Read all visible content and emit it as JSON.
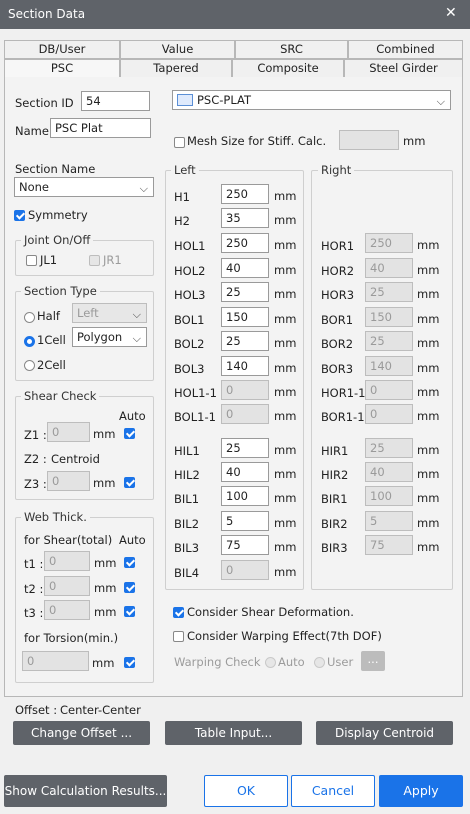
{
  "window": {
    "title": "Section Data",
    "close": "✕"
  },
  "tabs_row1": [
    "DB/User",
    "Value",
    "SRC",
    "Combined"
  ],
  "tabs_row2": [
    "PSC",
    "Tapered",
    "Composite",
    "Steel Girder"
  ],
  "section_id": {
    "label": "Section ID",
    "value": "54"
  },
  "name": {
    "label": "Name",
    "value": "PSC Plat"
  },
  "section_type_select": {
    "value": "PSC-PLAT"
  },
  "mesh": {
    "label": "Mesh Size for Stiff. Calc.",
    "unit": "mm",
    "value": ""
  },
  "section_name": {
    "label": "Section Name",
    "value": "None"
  },
  "symmetry": {
    "label": "Symmetry"
  },
  "joint": {
    "title": "Joint On/Off",
    "jl1": "JL1",
    "jr1": "JR1"
  },
  "stype": {
    "title": "Section Type",
    "half": "Half",
    "half_select": "Left",
    "cell1": "1Cell",
    "cell1_select": "Polygon",
    "cell2": "2Cell"
  },
  "shear": {
    "title": "Shear Check",
    "auto": "Auto",
    "z1": "Z1 :",
    "z1_val": "0",
    "z1_unit": "mm",
    "z2": "Z2 :",
    "z2_val": "Centroid",
    "z3": "Z3 :",
    "z3_val": "0",
    "z3_unit": "mm"
  },
  "web": {
    "title": "Web Thick.",
    "for_shear": "for Shear(total)",
    "auto": "Auto",
    "t1": "t1 :",
    "t1_val": "0",
    "t2": "t2 :",
    "t2_val": "0",
    "t3": "t3 :",
    "t3_val": "0",
    "unit": "mm",
    "for_torsion": "for Torsion(min.)",
    "tor_val": "0"
  },
  "left": {
    "title": "Left",
    "unit": "mm",
    "rows": [
      {
        "label": "H1",
        "value": "250",
        "enabled": true
      },
      {
        "label": "H2",
        "value": "35",
        "enabled": true
      },
      {
        "label": "HOL1",
        "value": "250",
        "enabled": true
      },
      {
        "label": "HOL2",
        "value": "40",
        "enabled": true
      },
      {
        "label": "HOL3",
        "value": "25",
        "enabled": true
      },
      {
        "label": "BOL1",
        "value": "150",
        "enabled": true
      },
      {
        "label": "BOL2",
        "value": "25",
        "enabled": true
      },
      {
        "label": "BOL3",
        "value": "140",
        "enabled": true
      },
      {
        "label": "HOL1-1",
        "value": "0",
        "enabled": false
      },
      {
        "label": "BOL1-1",
        "value": "0",
        "enabled": false
      },
      {
        "label": "HIL1",
        "value": "25",
        "enabled": true
      },
      {
        "label": "HIL2",
        "value": "40",
        "enabled": true
      },
      {
        "label": "BIL1",
        "value": "100",
        "enabled": true
      },
      {
        "label": "BIL2",
        "value": "5",
        "enabled": true
      },
      {
        "label": "BIL3",
        "value": "75",
        "enabled": true
      },
      {
        "label": "BIL4",
        "value": "0",
        "enabled": false
      }
    ]
  },
  "right": {
    "title": "Right",
    "unit": "mm",
    "rows": [
      {
        "label": "HOR1",
        "value": "250"
      },
      {
        "label": "HOR2",
        "value": "40"
      },
      {
        "label": "HOR3",
        "value": "25"
      },
      {
        "label": "BOR1",
        "value": "150"
      },
      {
        "label": "BOR2",
        "value": "25"
      },
      {
        "label": "BOR3",
        "value": "140"
      },
      {
        "label": "HOR1-1",
        "value": "0"
      },
      {
        "label": "BOR1-1",
        "value": "0"
      },
      {
        "label": "HIR1",
        "value": "25"
      },
      {
        "label": "HIR2",
        "value": "40"
      },
      {
        "label": "BIR1",
        "value": "100"
      },
      {
        "label": "BIR2",
        "value": "5"
      },
      {
        "label": "BIR3",
        "value": "75"
      }
    ]
  },
  "consider_shear": "Consider Shear Deformation.",
  "consider_warping": "Consider Warping Effect(7th DOF)",
  "warping": {
    "label": "Warping Check",
    "auto": "Auto",
    "user": "User",
    "more": "..."
  },
  "offset": {
    "label": "Offset :",
    "value": "Center-Center"
  },
  "buttons": {
    "change_offset": "Change Offset ...",
    "table_input": "Table Input...",
    "display_centroid": "Display Centroid",
    "show_results": "Show Calculation Results...",
    "ok": "OK",
    "cancel": "Cancel",
    "apply": "Apply"
  }
}
